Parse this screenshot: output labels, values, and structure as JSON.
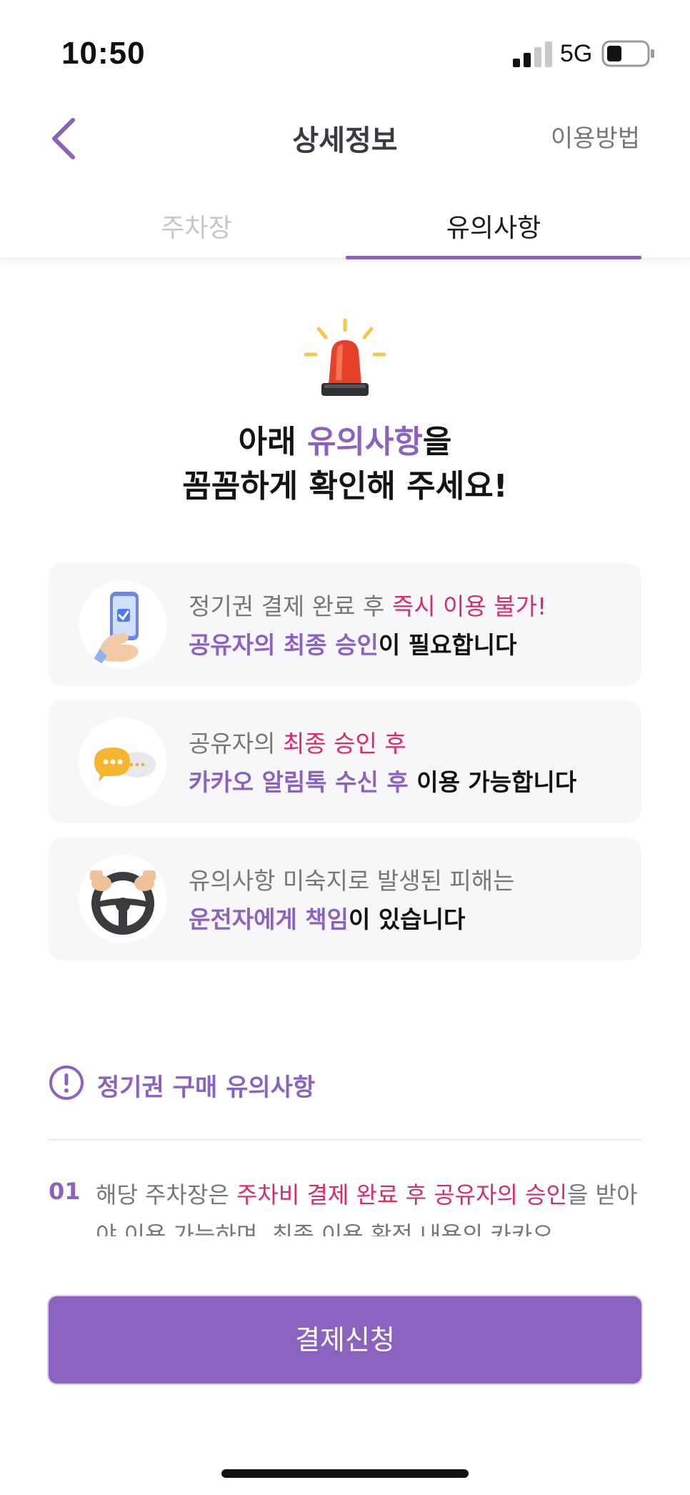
{
  "status": {
    "time": "10:50",
    "network": "5G"
  },
  "header": {
    "title": "상세정보",
    "howto": "이용방법"
  },
  "tabs": [
    {
      "label": "주차장"
    },
    {
      "label": "유의사항"
    }
  ],
  "hero": {
    "line1_pre": "아래 ",
    "line1_highlight": "유의사항",
    "line1_post": "을",
    "line2": "꼼꼼하게 확인해 주세요!"
  },
  "cards": [
    {
      "icon": "phone-check-icon",
      "line1_plain": "정기권 결제 완료 후 ",
      "line1_highlight": "즉시 이용 불가!",
      "line2_highlight": "공유자의 최종 승인",
      "line2_plain": "이 필요합니다"
    },
    {
      "icon": "kakao-chat-icon",
      "line1_plain": "공유자의 ",
      "line1_highlight": "최종 승인 후",
      "line2_highlight": "카카오 알림톡 수신 후",
      "line2_plain": " 이용 가능합니다"
    },
    {
      "icon": "steering-wheel-icon",
      "line1_plain": "유의사항 미숙지로 발생된 피해는",
      "line1_highlight": "",
      "line2_highlight": "운전자에게 책임",
      "line2_plain": "이 있습니다"
    }
  ],
  "section": {
    "title": "정기권 구매 유의사항"
  },
  "notice": {
    "number": "01",
    "text_pre": "해당 주차장은 ",
    "text_highlight": "주차비 결제 완료 후 공유자의 승인",
    "text_post": "을 받아야 이용 가능하며, 최종 이용 확정 내용의 카카오"
  },
  "pay_button": "결제신청",
  "colors": {
    "accent": "#8c62c0",
    "highlight": "#d92a6b",
    "card_bg": "#f7f7f9"
  }
}
